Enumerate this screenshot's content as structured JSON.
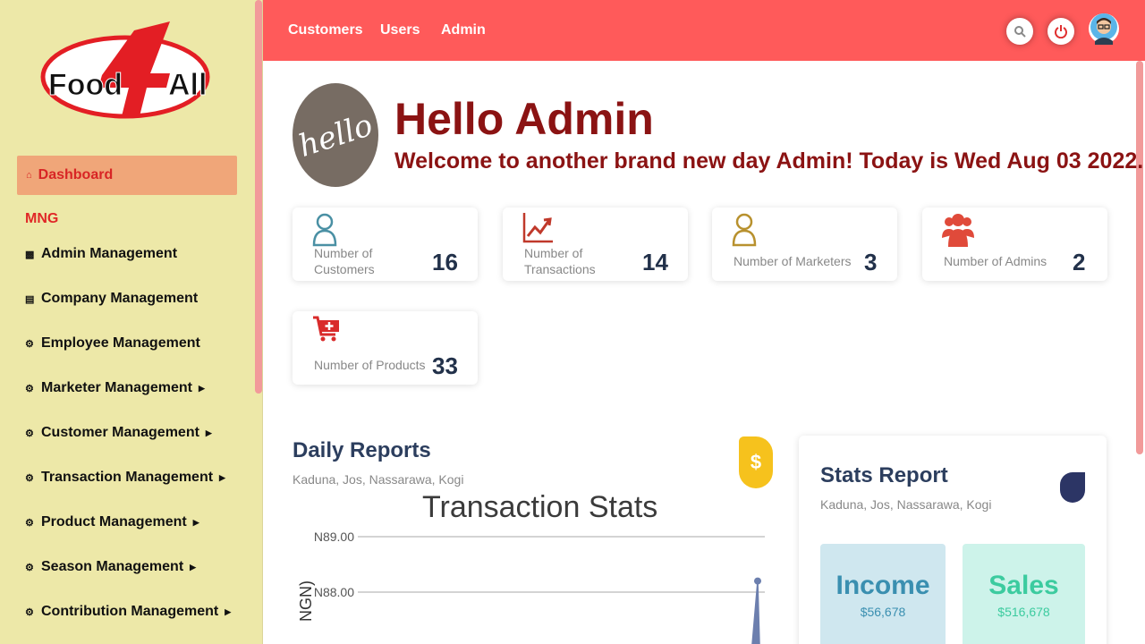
{
  "brand": {
    "logo_text": "Food4All"
  },
  "sidebar": {
    "active_item": "Dashboard",
    "section_label": "MNG",
    "items": [
      {
        "label": "Admin Management",
        "icon": "lock-icon",
        "has_submenu": false
      },
      {
        "label": "Company Management",
        "icon": "building-icon",
        "has_submenu": false
      },
      {
        "label": "Employee Management",
        "icon": "cogs-icon",
        "has_submenu": false
      },
      {
        "label": "Marketer Management",
        "icon": "cogs-icon",
        "has_submenu": true
      },
      {
        "label": "Customer Management",
        "icon": "cogs-icon",
        "has_submenu": true
      },
      {
        "label": "Transaction Management",
        "icon": "cogs-icon",
        "has_submenu": true
      },
      {
        "label": "Product Management",
        "icon": "cogs-icon",
        "has_submenu": true
      },
      {
        "label": "Season Management",
        "icon": "cogs-icon",
        "has_submenu": true
      },
      {
        "label": "Contribution Management",
        "icon": "cogs-icon",
        "has_submenu": true
      }
    ]
  },
  "topbar": {
    "nav": [
      "Customers",
      "Users",
      "Admin"
    ],
    "icons": [
      "search-icon",
      "power-icon",
      "user-avatar"
    ]
  },
  "greeting": {
    "image_text": "hello",
    "title": "Hello Admin",
    "subtitle": "Welcome to another brand new day Admin! Today is Wed Aug 03 2022."
  },
  "stats": [
    {
      "label_line1": "Number of",
      "label_line2": "Customers",
      "value": "16",
      "icon": "user-outline-icon",
      "icon_color": "#4a90a4"
    },
    {
      "label_line1": "Number of",
      "label_line2": "Transactions",
      "value": "14",
      "icon": "line-chart-icon",
      "icon_color": "#c0392b"
    },
    {
      "label_line1": "Number of Marketers",
      "label_line2": "",
      "value": "3",
      "icon": "user-outline-icon",
      "icon_color": "#b8912e"
    },
    {
      "label_line1": "Number of Admins",
      "label_line2": "",
      "value": "2",
      "icon": "users-icon",
      "icon_color": "#e04a3a"
    },
    {
      "label_line1": "Number of Products",
      "label_line2": "",
      "value": "33",
      "icon": "cart-plus-icon",
      "icon_color": "#d92b2b"
    }
  ],
  "daily_reports": {
    "title": "Daily Reports",
    "subtitle": "Kaduna, Jos, Nassarawa, Kogi",
    "badge_symbol": "$"
  },
  "chart_data": {
    "type": "line",
    "title": "Transaction Stats",
    "ylabel": "NGN)",
    "yticks": [
      "N89.00",
      "N88.00"
    ],
    "series": [
      {
        "values": [
          88.2
        ]
      }
    ],
    "ylim": [
      87,
      89
    ],
    "grid": true
  },
  "stats_report": {
    "title": "Stats Report",
    "subtitle": "Kaduna, Jos, Nassarawa, Kogi",
    "tiles": [
      {
        "label": "Income",
        "value": "$56,678",
        "bg": "#cfe7ef",
        "color": "#3a8fb0"
      },
      {
        "label": "Sales",
        "value": "$516,678",
        "bg": "#cdf3ea",
        "color": "#3ccb9f"
      }
    ]
  }
}
